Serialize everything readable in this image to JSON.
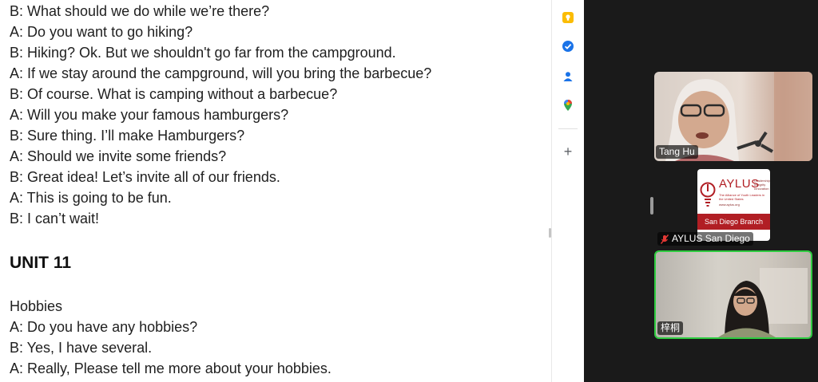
{
  "document": {
    "lines": [
      "B: What should we do while we’re there?",
      "A: Do you want to go hiking?",
      "B: Hiking? Ok. But we shouldn't go far from the campground.",
      "A: If we stay around the campground, will you bring the barbecue?",
      "B: Of course. What is camping without a barbecue?",
      "A: Will you make your famous hamburgers?",
      "B: Sure thing. I’ll make Hamburgers?",
      "A: Should we invite some friends?",
      "B: Great idea! Let’s invite all of our friends.",
      "A: This is going to be fun.",
      "B: I can’t wait!"
    ],
    "heading": "UNIT 11",
    "section_title": "Hobbies",
    "section_lines": [
      "A: Do you have any hobbies?",
      "B: Yes, I have several.",
      "A: Really, Please tell me more about your hobbies."
    ]
  },
  "side_panel": {
    "icons": [
      "keep-icon",
      "tasks-icon",
      "contacts-icon",
      "maps-icon"
    ],
    "add_label": "+"
  },
  "participants": [
    {
      "name": "Tang Hu"
    },
    {
      "name": "AYLUS San Diego",
      "muted": true,
      "logo": {
        "title": "AYLUS",
        "tagline": "The Alliance of Youth Leaders in the United States",
        "url": "www.aylus.org",
        "branch": "San Diego Branch",
        "sub_lines": [
          "Leadership",
          "Integrity",
          "Innovation"
        ]
      }
    },
    {
      "name": "梓桐",
      "active_speaker": true
    }
  ],
  "colors": {
    "active_speaker_border": "#2ecc40",
    "brand_red": "#b11e24",
    "muted_icon": "#e53935"
  }
}
